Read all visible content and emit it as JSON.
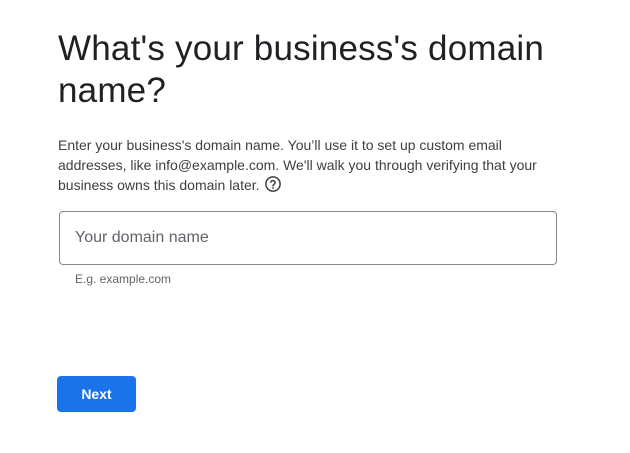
{
  "page": {
    "title": "What's your business's domain name?",
    "description": "Enter your business's domain name. You’ll use it to set up custom email addresses, like info@example.com. We'll walk you through verifying that your business owns this domain later."
  },
  "domain_field": {
    "placeholder": "Your domain name",
    "value": "",
    "helper": "E.g. example.com"
  },
  "help": {
    "icon": "help-circle-icon"
  },
  "actions": {
    "next_label": "Next"
  },
  "colors": {
    "primary": "#1a73e8",
    "text": "#202124",
    "secondary_text": "#5f6368",
    "border": "#80868b"
  }
}
